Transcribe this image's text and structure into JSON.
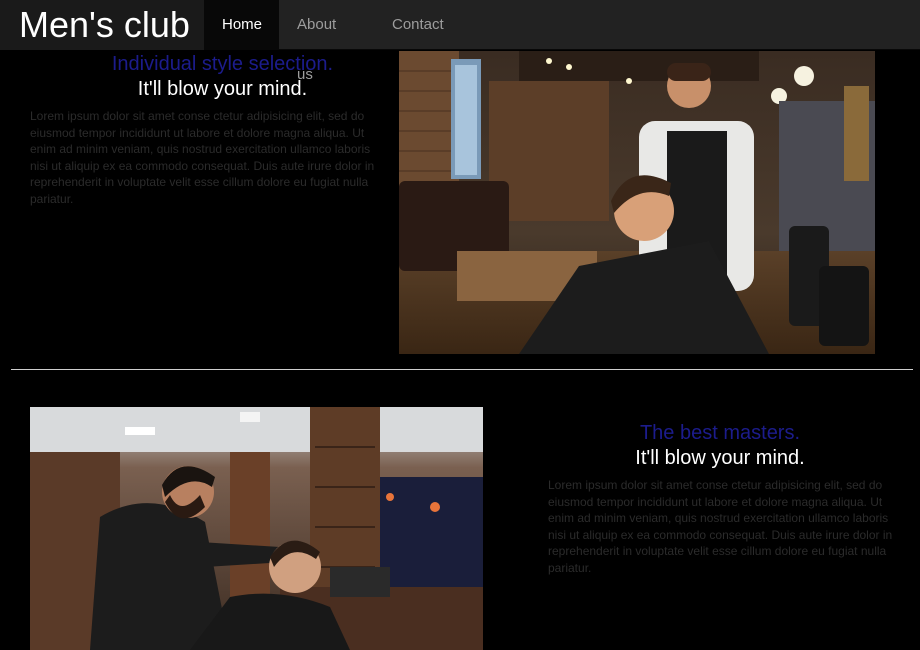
{
  "nav": {
    "brand": "Men's club",
    "items": [
      {
        "label": "Home",
        "active": true
      },
      {
        "label": "About us",
        "active": false
      },
      {
        "label": "Contact",
        "active": false
      }
    ]
  },
  "sections": [
    {
      "heading": "Individual style selection.",
      "subheading": "It'll blow your mind.",
      "text": "Lorem ipsum dolor sit amet conse ctetur adipisicing elit, sed do eiusmod tempor incididunt ut labore et dolore magna aliqua. Ut enim ad minim veniam, quis nostrud exercitation ullamco laboris nisi ut aliquip ex ea commodo consequat. Duis aute irure dolor in reprehenderit in voluptate velit esse cillum dolore eu fugiat nulla pariatur."
    },
    {
      "heading": "The best masters.",
      "subheading": "It'll blow your mind.",
      "text": "Lorem ipsum dolor sit amet conse ctetur adipisicing elit, sed do eiusmod tempor incididunt ut labore et dolore magna aliqua. Ut enim ad minim veniam, quis nostrud exercitation ullamco laboris nisi ut aliquip ex ea commodo consequat. Duis aute irure dolor in reprehenderit in voluptate velit esse cillum dolore eu fugiat nulla pariatur."
    }
  ],
  "colors": {
    "background": "#000000",
    "navbar": "#222222",
    "heading": "#1c1c8c",
    "subheading": "#ffffff",
    "paragraph": "#2b2b2b"
  }
}
